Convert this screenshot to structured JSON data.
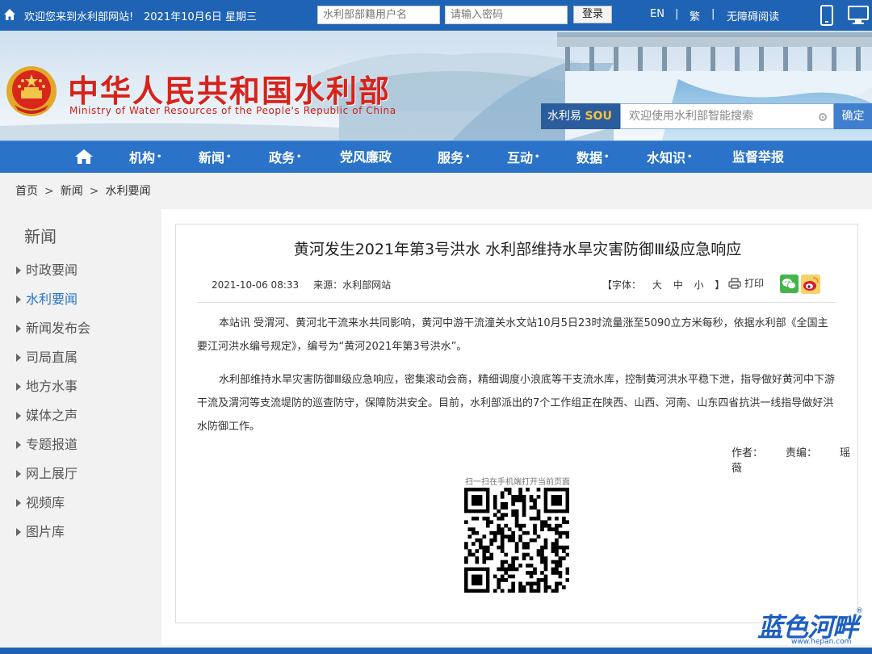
{
  "topbar": {
    "welcome": "欢迎您来到水利部网站!",
    "date": "2021年10月6日 星期三",
    "username_placeholder": "水利部部籍用户名",
    "password_placeholder": "请输入密码",
    "login_label": "登录",
    "lang_en": "EN",
    "lang_trad": "繁",
    "accessibility": "无障碍阅读",
    "separator": "|"
  },
  "banner": {
    "title": "中华人民共和国水利部",
    "subtitle": "Ministry of Water Resources of the People's Republic of China"
  },
  "search": {
    "brand_prefix": "水利易",
    "brand_suffix": "SOU",
    "placeholder": "欢迎使用水利部智能搜索",
    "button": "确定"
  },
  "nav": {
    "items": [
      "机构",
      "新闻",
      "政务",
      "党风廉政",
      "服务",
      "互动",
      "数据",
      "水知识",
      "监督举报"
    ],
    "dot": "•"
  },
  "breadcrumb": {
    "items": [
      "首页",
      "新闻",
      "水利要闻"
    ],
    "separator": ">"
  },
  "sidebar": {
    "heading": "新闻",
    "items": [
      "时政要闻",
      "水利要闻",
      "新闻发布会",
      "司局直属",
      "地方水事",
      "媒体之声",
      "专题报道",
      "网上展厅",
      "视频库",
      "图片库"
    ],
    "active_index": 1
  },
  "article": {
    "title": "黄河发生2021年第3号洪水 水利部维持水旱灾害防御Ⅲ级应急响应",
    "datetime": "2021-10-06 08:33",
    "source": "来源：水利部网站",
    "font_label": "【字体：",
    "font_large": "大",
    "font_medium": "中",
    "font_small": "小",
    "font_close": "】",
    "print_label": "打印",
    "paragraph1": "本站讯 受渭河、黄河北干流来水共同影响，黄河中游干流潼关水文站10月5日23时流量涨至5090立方米每秒，依据水利部《全国主要江河洪水编号规定》，编号为“黄河2021年第3号洪水”。",
    "paragraph2": "水利部维持水旱灾害防御Ⅲ级应急响应，密集滚动会商，精细调度小浪底等干支流水库，控制黄河洪水平稳下泄，指导做好黄河中下游干流及渭河等支流堤防的巡查防守，保障防洪安全。目前，水利部派出的7个工作组正在陕西、山西、河南、山东四省抗洪一线指导做好洪水防御工作。",
    "author_label": "作者：",
    "editor_label": "责编：",
    "editor_name": "瑶薇",
    "qr_caption": "扫一扫在手机端打开当前页面"
  },
  "watermark": {
    "text": "蓝色河畔",
    "url": "www.hepan.com",
    "reg": "®"
  },
  "colors": {
    "topbar": "#1f63b5",
    "nav": "#2a73c8",
    "title_red": "#d6231c",
    "active_link": "#2a73c8"
  }
}
